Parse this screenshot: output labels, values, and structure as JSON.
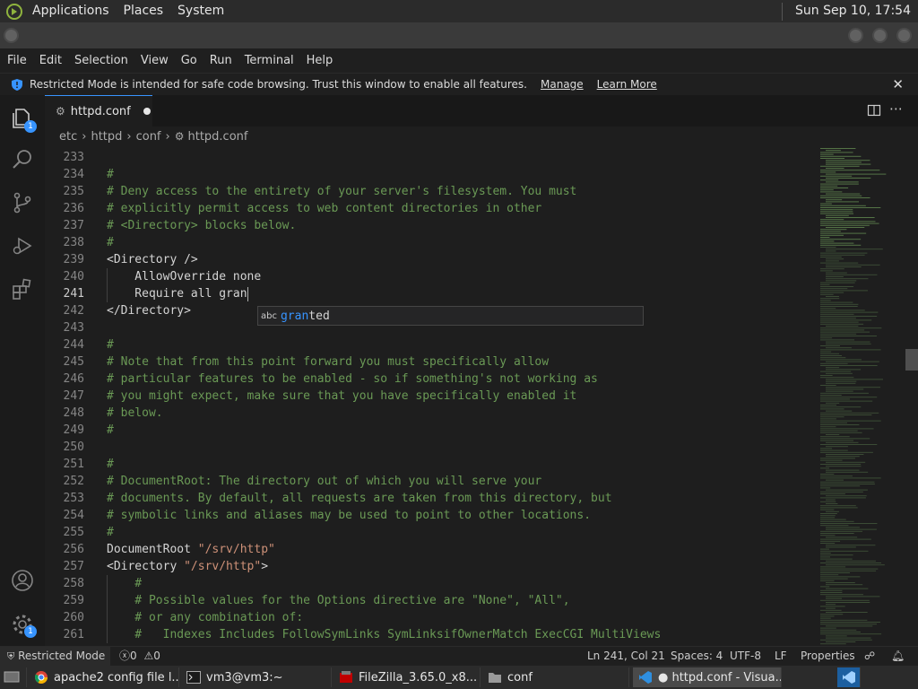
{
  "topbar": {
    "menus": [
      "Applications",
      "Places",
      "System"
    ],
    "clock": "Sun Sep 10, 17:54"
  },
  "menubar": [
    "File",
    "Edit",
    "Selection",
    "View",
    "Go",
    "Run",
    "Terminal",
    "Help"
  ],
  "banner": {
    "message": "Restricted Mode is intended for safe code browsing. Trust this window to enable all features.",
    "manage": "Manage",
    "learn_more": "Learn More"
  },
  "activity": {
    "explorer_badge": "1",
    "settings_badge": "1"
  },
  "tab": {
    "title": "httpd.conf"
  },
  "breadcrumb": {
    "parts": [
      "etc",
      "httpd",
      "conf",
      "httpd.conf"
    ]
  },
  "editor": {
    "lines": [
      {
        "n": "233",
        "text": ""
      },
      {
        "n": "234",
        "text": "#"
      },
      {
        "n": "235",
        "text": "# Deny access to the entirety of your server's filesystem. You must"
      },
      {
        "n": "236",
        "text": "# explicitly permit access to web content directories in other"
      },
      {
        "n": "237",
        "text": "# <Directory> blocks below."
      },
      {
        "n": "238",
        "text": "#"
      },
      {
        "n": "239",
        "text": "<Directory />"
      },
      {
        "n": "240",
        "text": "    AllowOverride none"
      },
      {
        "n": "241",
        "text": "    Require all gran"
      },
      {
        "n": "242",
        "text": "</Directory>"
      },
      {
        "n": "243",
        "text": ""
      },
      {
        "n": "244",
        "text": "#"
      },
      {
        "n": "245",
        "text": "# Note that from this point forward you must specifically allow"
      },
      {
        "n": "246",
        "text": "# particular features to be enabled - so if something's not working as"
      },
      {
        "n": "247",
        "text": "# you might expect, make sure that you have specifically enabled it"
      },
      {
        "n": "248",
        "text": "# below."
      },
      {
        "n": "249",
        "text": "#"
      },
      {
        "n": "250",
        "text": ""
      },
      {
        "n": "251",
        "text": "#"
      },
      {
        "n": "252",
        "text": "# DocumentRoot: The directory out of which you will serve your"
      },
      {
        "n": "253",
        "text": "# documents. By default, all requests are taken from this directory, but"
      },
      {
        "n": "254",
        "text": "# symbolic links and aliases may be used to point to other locations."
      },
      {
        "n": "255",
        "text": "#"
      },
      {
        "n": "256",
        "text": "DocumentRoot \"/srv/http\""
      },
      {
        "n": "257",
        "text": "<Directory \"/srv/http\">"
      },
      {
        "n": "258",
        "text": "    #"
      },
      {
        "n": "259",
        "text": "    # Possible values for the Options directive are \"None\", \"All\","
      },
      {
        "n": "260",
        "text": "    # or any combination of:"
      },
      {
        "n": "261",
        "text": "    #   Indexes Includes FollowSymLinks SymLinksifOwnerMatch ExecCGI MultiViews"
      }
    ]
  },
  "suggest": {
    "kind": "abc",
    "match": "gran",
    "rest": "ted"
  },
  "statusbar": {
    "restricted": "Restricted Mode",
    "errors": "0",
    "warnings": "0",
    "position": "Ln 241, Col 21",
    "spaces": "Spaces: 4",
    "encoding": "UTF-8",
    "eol": "LF",
    "language": "Properties"
  },
  "taskbar": {
    "items": [
      {
        "label": "apache2 config file l...",
        "icon": "chrome-icon"
      },
      {
        "label": "vm3@vm3:~",
        "icon": "terminal-icon"
      },
      {
        "label": "FileZilla_3.65.0_x8...",
        "icon": "filezilla-icon"
      },
      {
        "label": "conf",
        "icon": "folder-icon"
      },
      {
        "label": "● httpd.conf - Visua...",
        "icon": "vscode-icon"
      }
    ]
  },
  "colors": {
    "accent": "#3794ff",
    "comment": "#6a9955",
    "string": "#ce9178",
    "text": "#d4d4d4",
    "line_number": "#858585"
  }
}
